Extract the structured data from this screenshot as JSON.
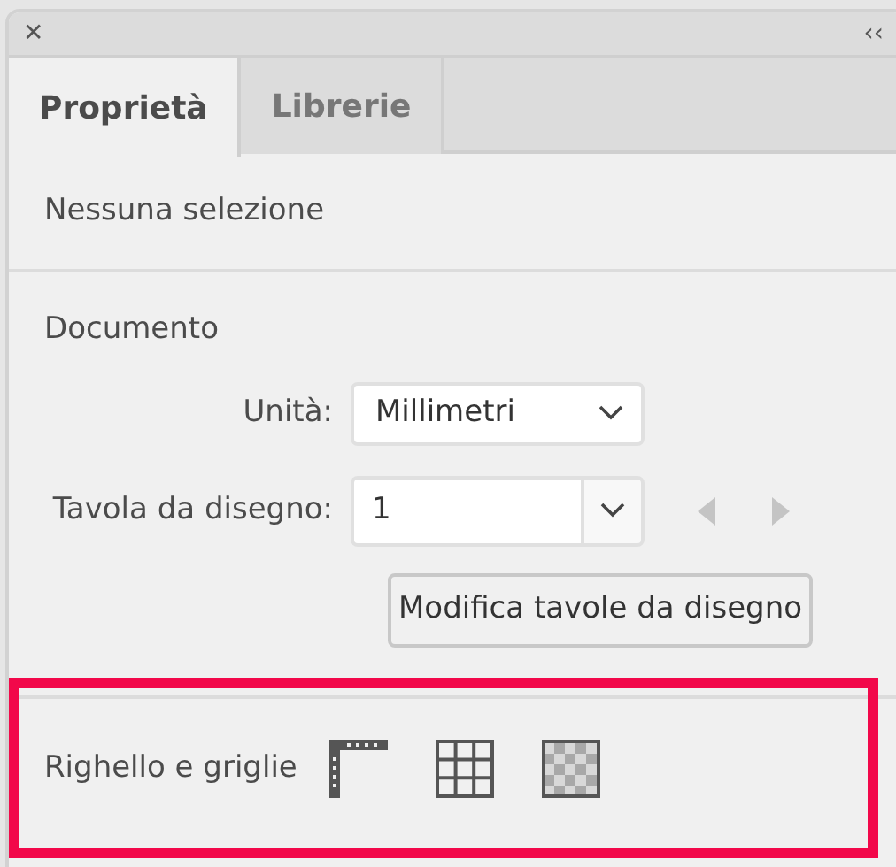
{
  "panel": {
    "close": "✕",
    "collapse": "‹‹"
  },
  "tabs": [
    {
      "label": "Proprietà",
      "selected": true
    },
    {
      "label": "Librerie",
      "selected": false
    }
  ],
  "selection_status": "Nessuna selezione",
  "document": {
    "heading": "Documento",
    "units": {
      "label": "Unità:",
      "value": "Millimetri"
    },
    "artboard": {
      "label": "Tavola da disegno:",
      "value": "1",
      "prev_disabled": true,
      "next_disabled": true
    },
    "edit_button": "Modifica tavole da disegno"
  },
  "rulers_grids": {
    "label": "Righello e griglie",
    "highlighted": true,
    "tools": [
      {
        "kind": "ruler"
      },
      {
        "kind": "grid"
      },
      {
        "kind": "transparency"
      }
    ]
  }
}
